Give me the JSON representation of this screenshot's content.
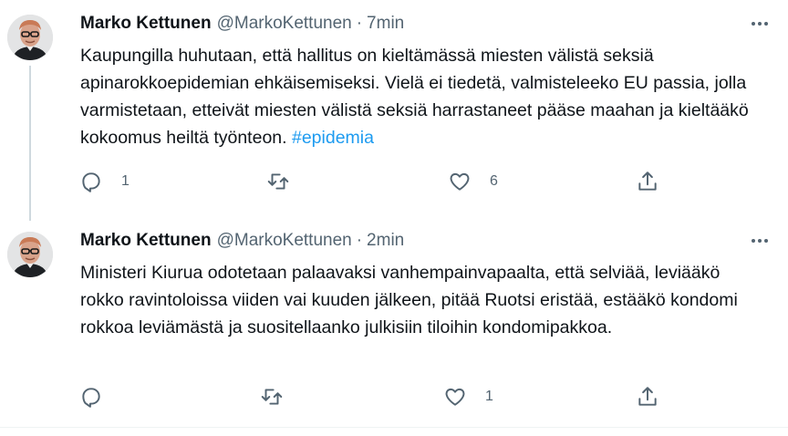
{
  "tweets": [
    {
      "author_name": "Marko Kettunen",
      "handle": "@MarkoKettunen",
      "separator": "·",
      "time": "7min",
      "text": "Kaupungilla huhutaan, että hallitus on kieltämässä miesten välistä seksiä apinarokkoepidemian ehkäisemiseksi. Vielä ei tiedetä, valmisteleeko EU passia, jolla varmistetaan, etteivät miesten välistä seksiä harrastaneet pääse maahan ja kieltääkö kokoomus heiltä työnteon.",
      "hashtag": "#epidemia",
      "reply_count": "1",
      "retweet_count": "",
      "like_count": "6"
    },
    {
      "author_name": "Marko Kettunen",
      "handle": "@MarkoKettunen",
      "separator": "·",
      "time": "2min",
      "text": "Ministeri Kiurua odotetaan palaavaksi vanhempainvapaalta, että selviää, leviääkö rokko ravintoloissa viiden vai kuuden jälkeen, pitää Ruotsi eristää, estääkö kondomi rokkoa leviämästä ja suositellaanko julkisiin tiloihin kondomipakkoa.",
      "hashtag": "",
      "reply_count": "",
      "retweet_count": "",
      "like_count": "1"
    }
  ],
  "icons": {
    "reply": "reply-icon",
    "retweet": "retweet-icon",
    "like": "heart-icon",
    "share": "share-icon",
    "more": "more-icon"
  },
  "colors": {
    "link": "#1d9bf0",
    "secondary_text": "#536471",
    "primary_text": "#0f1419",
    "thread_line": "#cfd9de"
  }
}
